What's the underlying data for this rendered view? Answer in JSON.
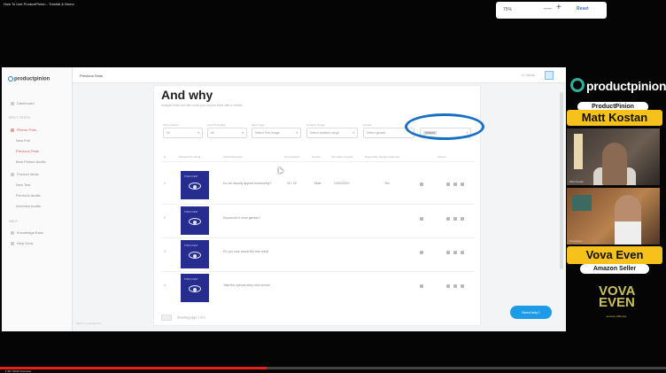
{
  "video": {
    "title": "How To Use ProductPinion - Tutorial & Demo",
    "progress": 0.4,
    "controls_text": "1:38 / 50:54  Overview"
  },
  "zoom": {
    "value": "75%",
    "minus": "—",
    "plus": "+",
    "reset": "Reset"
  },
  "app": {
    "logo": "productpinion",
    "topbar_title": "Previous Tests",
    "topbar_right": "1/1 Minute",
    "sidebar": {
      "dashboard": "Dashboard",
      "section_tests": "SPLIT TESTS",
      "items": [
        {
          "label": "Picture Polls",
          "active": true
        },
        {
          "label": "New Poll",
          "active": false
        },
        {
          "label": "Previous Tests",
          "active": true
        },
        {
          "label": "Best Picture Audits",
          "active": false
        },
        {
          "label": "Product Ideas",
          "active": false
        },
        {
          "label": "New Test",
          "active": false
        },
        {
          "label": "Previous Audits",
          "active": false
        },
        {
          "label": "Interview Audits",
          "active": false
        }
      ],
      "section_help": "HELP",
      "help_items": [
        "Knowledge Base",
        "Help Desk"
      ]
    },
    "panel": {
      "heading": "And why",
      "subtitle": "Analyze tests and see what your buyers think with a verdict",
      "filters": [
        {
          "label": "Show entries",
          "value": "10"
        },
        {
          "label": "Auto-Price filter",
          "value": "All"
        },
        {
          "label": "Test Image",
          "value": "Select Test Image"
        },
        {
          "label": "Creation Range",
          "value": "Select creation range"
        },
        {
          "label": "Gender",
          "value": "Select gender"
        },
        {
          "label": "",
          "value": "Search"
        }
      ],
      "columns": [
        "#",
        "Picture/Thumbnail",
        "Verdict/Question",
        "Test Answers",
        "Gender",
        "Test Date Created",
        "Reply Rate (Target Audience)",
        "Actions"
      ],
      "rows": [
        {
          "num": "1",
          "question": "Do we visually appear trustworthy?",
          "answers": "25 / 25",
          "gender": "Male",
          "date": "13/04/2020",
          "rate": "Yes"
        },
        {
          "num": "2",
          "question": "Keywords in mind gamble?",
          "answers": "",
          "gender": "",
          "date": "",
          "rate": ""
        },
        {
          "num": "3",
          "question": "Do you care about this test result",
          "answers": "",
          "gender": "",
          "date": "",
          "rate": ""
        },
        {
          "num": "4",
          "question": "Take the optimal story next winner",
          "answers": "",
          "gender": "",
          "date": "",
          "rate": ""
        }
      ],
      "thumb_label": "TOOLS TEST",
      "pager_text": "Showing page 1 of 1"
    },
    "chat_button": "Need help?",
    "footer_text": "2023 © productpinion"
  },
  "overlay": {
    "brand": "productpinion",
    "host_tag": "ProductPinion",
    "host_name": "Matt Kostan",
    "cam1_tag": "Matt Kostan",
    "cam2_tag": "Vova Even",
    "guest_name": "Vova Even",
    "guest_tag": "Amazon Seller",
    "guest_logo_top": "VOVA",
    "guest_logo_bottom": "EVEN",
    "guest_logo_sub": "amazon FBA tips"
  }
}
